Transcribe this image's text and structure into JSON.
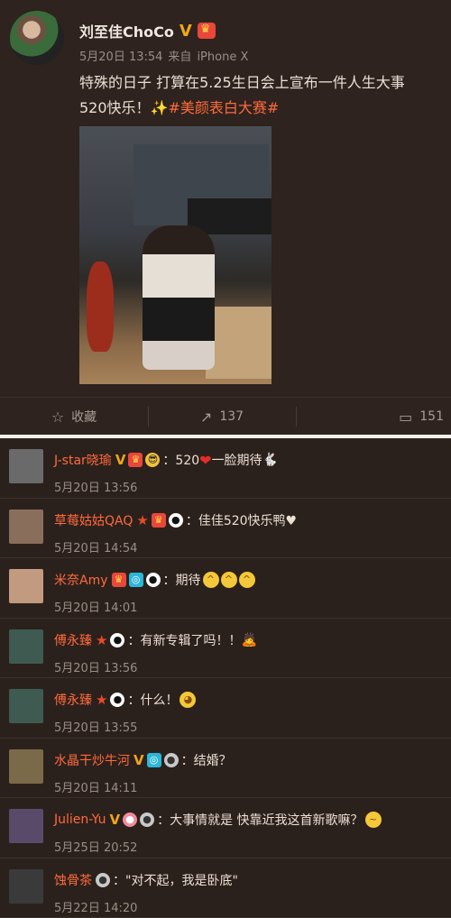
{
  "post": {
    "author": "刘至佳ChoCo",
    "verified_mark": "V",
    "time": "5月20日 13:54",
    "source_prefix": "来自",
    "source": "iPhone X",
    "text_line1": "特殊的日子 打算在5.25生日会上宣布一件人生大事",
    "text_line2": "520快乐！",
    "sparkle": "✨",
    "hashtag": "#美颜表白大赛#"
  },
  "actions": {
    "favorite_label": "收藏",
    "repost_count": "137",
    "comment_count": "151"
  },
  "comments": [
    {
      "name": "J-star晓瑜",
      "badges": [
        "v",
        "crown",
        "cool"
      ],
      "text": "：520",
      "extra": "heart",
      "text2": "一脸期待",
      "emoji_after": "🐇",
      "time": "5月20日 13:56"
    },
    {
      "name": "草莓姑姑QAQ",
      "badges": [
        "star",
        "crown",
        "panda"
      ],
      "text": "：佳佳520快乐鸭♥",
      "time": "5月20日 14:54"
    },
    {
      "name": "米奈Amy",
      "badges": [
        "crown",
        "cam",
        "panda"
      ],
      "text": "：期待",
      "emojis": 3,
      "time": "5月20日 14:01"
    },
    {
      "name": "傅永臻",
      "badges": [
        "star",
        "panda"
      ],
      "text": "：有新专辑了吗！！",
      "emoji_after": "🙇",
      "time": "5月20日 13:56"
    },
    {
      "name": "傅永臻",
      "badges": [
        "star",
        "panda"
      ],
      "text": "：什么！",
      "emoji_after": "🐶",
      "time": "5月20日 13:55"
    },
    {
      "name": "水晶干炒牛河",
      "badges": [
        "v",
        "cam",
        "bot"
      ],
      "text": "：结婚？",
      "time": "5月20日 14:11"
    },
    {
      "name": "Julien-Yu",
      "badges": [
        "v",
        "pink",
        "bot"
      ],
      "text": "：大事情就是 快靠近我这首新歌嘛？",
      "emoji_after": "😔",
      "time": "5月25日 20:52"
    },
    {
      "name": "蚀骨茶",
      "badges": [
        "bot"
      ],
      "text": "：\"对不起，我是卧底\"",
      "time": "5月22日 14:20"
    }
  ],
  "colors": {
    "accent": "#ff6a3d",
    "verified": "#f2a619",
    "background": "#2b211c"
  }
}
